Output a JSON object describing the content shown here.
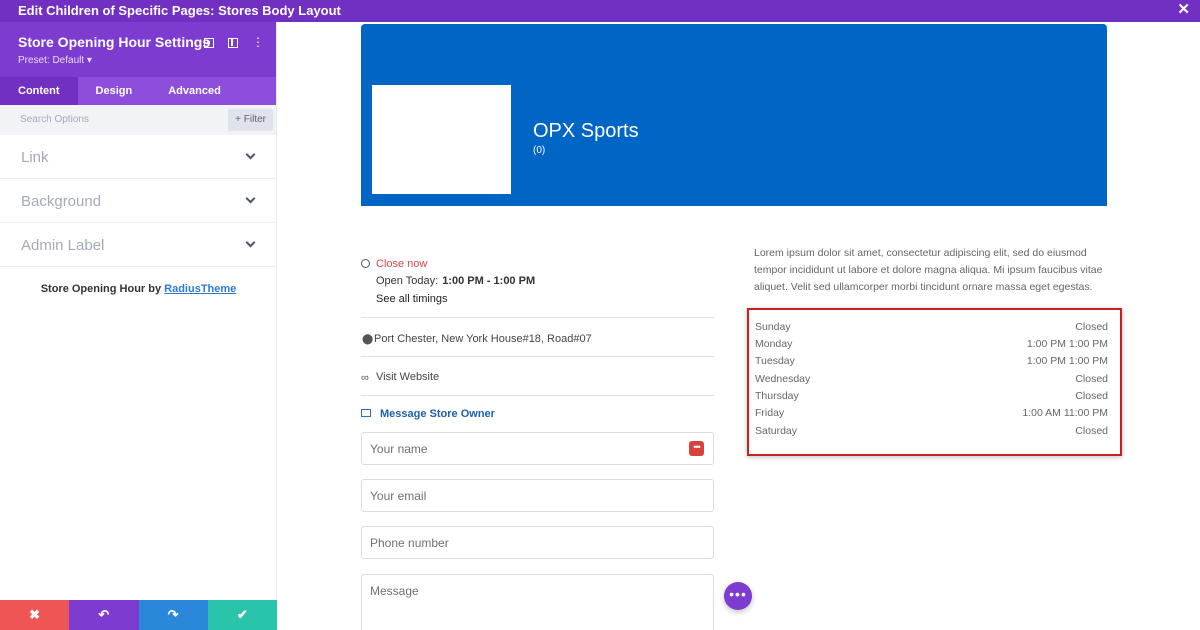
{
  "window": {
    "title": "Edit Children of Specific Pages: Stores Body Layout",
    "close_icon": "close-icon"
  },
  "panel": {
    "title": "Store Opening Hour Settings",
    "preset": "Preset: Default ▾",
    "tabs": [
      {
        "label": "Content",
        "active": true
      },
      {
        "label": "Design",
        "active": false
      },
      {
        "label": "Advanced",
        "active": false
      }
    ],
    "search_placeholder": "Search Options",
    "filter_label": "+ Filter",
    "toggles": [
      {
        "label": "Link"
      },
      {
        "label": "Background"
      },
      {
        "label": "Admin Label"
      }
    ],
    "credit_prefix": "Store Opening Hour by ",
    "credit_link": "RadiusTheme",
    "bottom_actions": {
      "cancel": "✖",
      "undo": "↶",
      "redo": "↷",
      "save": "✔"
    }
  },
  "store": {
    "name": "OPX Sports",
    "rating": "(0)",
    "status": "Close now",
    "open_today_label": "Open Today:",
    "open_today_hours": "1:00 PM  - 1:00 PM",
    "see_all": "See all timings",
    "address": "Port Chester, New York House#18, Road#07",
    "website": "Visit Website",
    "message_owner": "Message Store Owner",
    "form": {
      "name_placeholder": "Your name",
      "email_placeholder": "Your email",
      "phone_placeholder": "Phone number",
      "message_placeholder": "Message"
    },
    "description": "Lorem ipsum dolor sit amet, consectetur adipiscing elit, sed do eiusmod tempor incididunt ut labore et dolore magna aliqua. Mi ipsum faucibus vitae aliquet. Velit sed ullamcorper morbi tincidunt ornare massa eget egestas.",
    "hours": [
      {
        "day": "Sunday",
        "time": "Closed"
      },
      {
        "day": "Monday",
        "time": "1:00 PM 1:00 PM"
      },
      {
        "day": "Tuesday",
        "time": "1:00 PM 1:00 PM"
      },
      {
        "day": "Wednesday",
        "time": "Closed"
      },
      {
        "day": "Thursday",
        "time": "Closed"
      },
      {
        "day": "Friday",
        "time": "1:00 AM 11:00 PM"
      },
      {
        "day": "Saturday",
        "time": "Closed"
      }
    ]
  },
  "fab_label": "•••",
  "colors": {
    "builder_purple": "#7130c1",
    "hero_blue": "#0066c5",
    "highlight_red": "#cc1f1f",
    "cancel_red": "#ef5555",
    "redo_blue": "#2b87da",
    "save_teal": "#29c4a9"
  }
}
